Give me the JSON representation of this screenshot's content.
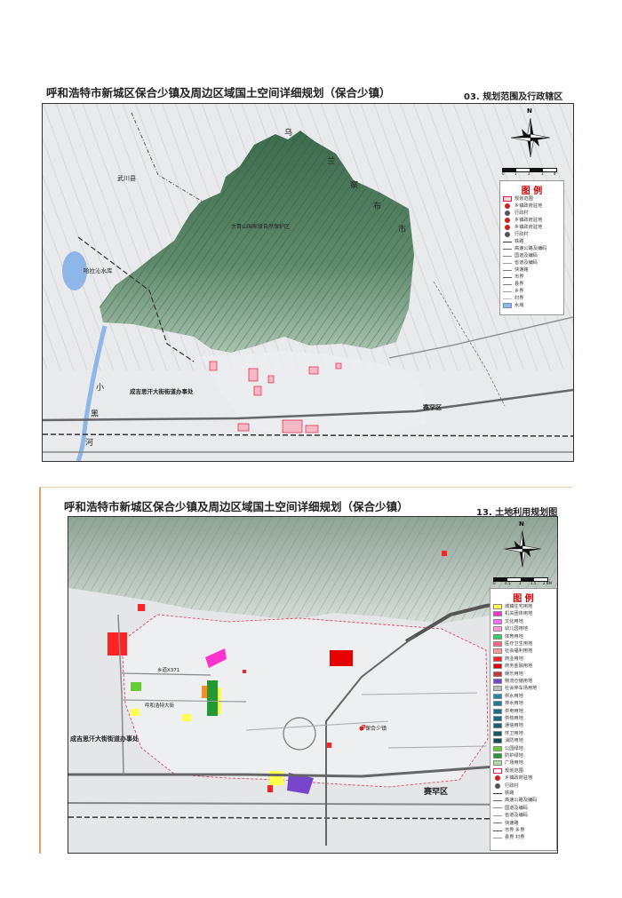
{
  "sheets": [
    {
      "title": "呼和浩特市新城区保合少镇及周边区域国土空间详细规划（保合少镇）",
      "code": "03. 规划范围及行政辖区",
      "north": "N",
      "scale_ticks": [
        "0",
        "1",
        "2",
        "3",
        "4"
      ],
      "legend_title": "图 例",
      "legend": [
        {
          "label": "规划范围",
          "kind": "box",
          "color": "#f7d6dc",
          "border": "#e0204a"
        },
        {
          "label": "乡镇政府驻地",
          "kind": "symbol",
          "color": "#d02020"
        },
        {
          "label": "行政村",
          "kind": "symbol",
          "color": "#555555"
        },
        {
          "label": "乡镇政府驻地",
          "kind": "symbol",
          "color": "#d02020"
        },
        {
          "label": "乡镇政府驻地",
          "kind": "symbol",
          "color": "#d02020"
        },
        {
          "label": "行政村",
          "kind": "symbol",
          "color": "#555555"
        },
        {
          "label": "铁路",
          "kind": "line",
          "color": "#333333"
        },
        {
          "label": "高速公路及编码",
          "kind": "line",
          "color": "#666666"
        },
        {
          "label": "国道及编码",
          "kind": "line",
          "color": "#888888"
        },
        {
          "label": "省道及编码",
          "kind": "line",
          "color": "#999999"
        },
        {
          "label": "快速路",
          "kind": "line",
          "color": "#777777"
        },
        {
          "label": "市界",
          "kind": "line",
          "color": "#555555"
        },
        {
          "label": "县界",
          "kind": "line",
          "color": "#777777"
        },
        {
          "label": "乡界",
          "kind": "line",
          "color": "#999999"
        },
        {
          "label": "村界",
          "kind": "line",
          "color": "#bbbbbb"
        },
        {
          "label": "水域",
          "kind": "box",
          "color": "#8fb6e8",
          "border": "#6a93c8"
        }
      ],
      "map_labels": {
        "wuchuan": "武川县",
        "reservoir": "哈拉沁水库",
        "wu": "乌",
        "lan": "兰",
        "cha": "察",
        "bu": "布",
        "shi": "市",
        "reserve": "大青山国家级自然保护区",
        "chengji": "成吉思汗大街街道办事处",
        "saihan": "赛罕区",
        "xiao": "小",
        "hei": "黑",
        "he": "河"
      }
    },
    {
      "title": "呼和浩特市新城区保合少镇及周边区域国土空间详细规划（保合少镇）",
      "code": "13. 土地利用规划图",
      "north": "N",
      "scale_ticks": [
        "0",
        "0.5",
        "1",
        "1.5",
        "2 KM"
      ],
      "legend_title": "图 例",
      "legend": [
        {
          "label": "城镇住宅用地",
          "kind": "box",
          "color": "#ffff4d",
          "border": "#888888"
        },
        {
          "label": "机关团体用地",
          "kind": "box",
          "color": "#ff33cc",
          "border": "#888888"
        },
        {
          "label": "文化用地",
          "kind": "box",
          "color": "#ff66ff",
          "border": "#888888"
        },
        {
          "label": "幼儿园用地",
          "kind": "box",
          "color": "#ff99cc",
          "border": "#888888"
        },
        {
          "label": "体育用地",
          "kind": "box",
          "color": "#33cc66",
          "border": "#888888"
        },
        {
          "label": "医疗卫生用地",
          "kind": "box",
          "color": "#ff6680",
          "border": "#888888"
        },
        {
          "label": "社会福利用地",
          "kind": "box",
          "color": "#ff9999",
          "border": "#888888"
        },
        {
          "label": "商业用地",
          "kind": "box",
          "color": "#ff2222",
          "border": "#888888"
        },
        {
          "label": "商务金融用地",
          "kind": "box",
          "color": "#e60000",
          "border": "#888888"
        },
        {
          "label": "娱乐用地",
          "kind": "box",
          "color": "#cc3333",
          "border": "#888888"
        },
        {
          "label": "物流仓储用地",
          "kind": "box",
          "color": "#7744cc",
          "border": "#888888"
        },
        {
          "label": "社会停车场用地",
          "kind": "box",
          "color": "#bbbbbb",
          "border": "#888888"
        },
        {
          "label": "供水用地",
          "kind": "box",
          "color": "#2288aa",
          "border": "#888888"
        },
        {
          "label": "排水用地",
          "kind": "box",
          "color": "#1f7a99",
          "border": "#888888"
        },
        {
          "label": "供电用地",
          "kind": "box",
          "color": "#1a6f8c",
          "border": "#888888"
        },
        {
          "label": "供热用地",
          "kind": "box",
          "color": "#1a6680",
          "border": "#888888"
        },
        {
          "label": "通信用地",
          "kind": "box",
          "color": "#186075",
          "border": "#888888"
        },
        {
          "label": "环卫用地",
          "kind": "box",
          "color": "#16566b",
          "border": "#888888"
        },
        {
          "label": "消防用地",
          "kind": "box",
          "color": "#144d60",
          "border": "#888888"
        },
        {
          "label": "公园绿地",
          "kind": "box",
          "color": "#66cc33",
          "border": "#888888"
        },
        {
          "label": "防护绿地",
          "kind": "box",
          "color": "#229933",
          "border": "#888888"
        },
        {
          "label": "广场用地",
          "kind": "box",
          "color": "#aaddaa",
          "border": "#888888"
        },
        {
          "label": "规划范围",
          "kind": "box",
          "color": "#ffffff",
          "border": "#e0204a"
        },
        {
          "label": "乡镇政府驻地",
          "kind": "symbol",
          "color": "#d02020"
        },
        {
          "label": "行政村",
          "kind": "symbol",
          "color": "#555555"
        },
        {
          "label": "铁路",
          "kind": "line",
          "color": "#333333"
        },
        {
          "label": "高速公路及编码",
          "kind": "line",
          "color": "#666666"
        },
        {
          "label": "国道及编码",
          "kind": "line",
          "color": "#888888"
        },
        {
          "label": "省道及编码",
          "kind": "line",
          "color": "#999999"
        },
        {
          "label": "快速路",
          "kind": "line",
          "color": "#777777"
        },
        {
          "label": "市界      乡界",
          "kind": "line",
          "color": "#555555"
        },
        {
          "label": "县界      村界",
          "kind": "line",
          "color": "#999999"
        }
      ],
      "map_labels": {
        "chengji": "成吉思汗大街街道办事处",
        "saihan": "赛罕区",
        "baohe": "保合少镇",
        "huhe": "呼和浩特大街",
        "xiangdao": "乡道X371"
      }
    }
  ]
}
